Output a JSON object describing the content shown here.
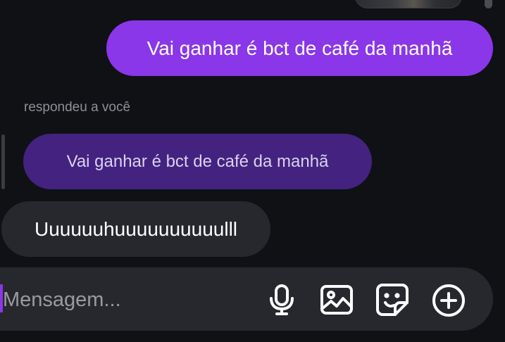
{
  "messages": {
    "sent": {
      "text": "Vai ganhar é bct de café da manhã"
    },
    "reply_label": "respondeu a você",
    "quoted": {
      "text": "Vai ganhar é bct de café da manhã"
    },
    "received": {
      "text": "Uuuuuuhuuuuuuuuuulll"
    }
  },
  "composer": {
    "placeholder": "Mensagem...",
    "value": ""
  },
  "icons": {
    "mic": "microphone-icon",
    "gallery": "image-icon",
    "sticker": "sticker-icon",
    "plus": "plus-circle-icon"
  },
  "colors": {
    "background": "#0f1115",
    "sent_bubble": "#8a36e9",
    "quoted_bubble": "#44227f",
    "received_bubble": "#26282d",
    "composer": "#26282d"
  }
}
